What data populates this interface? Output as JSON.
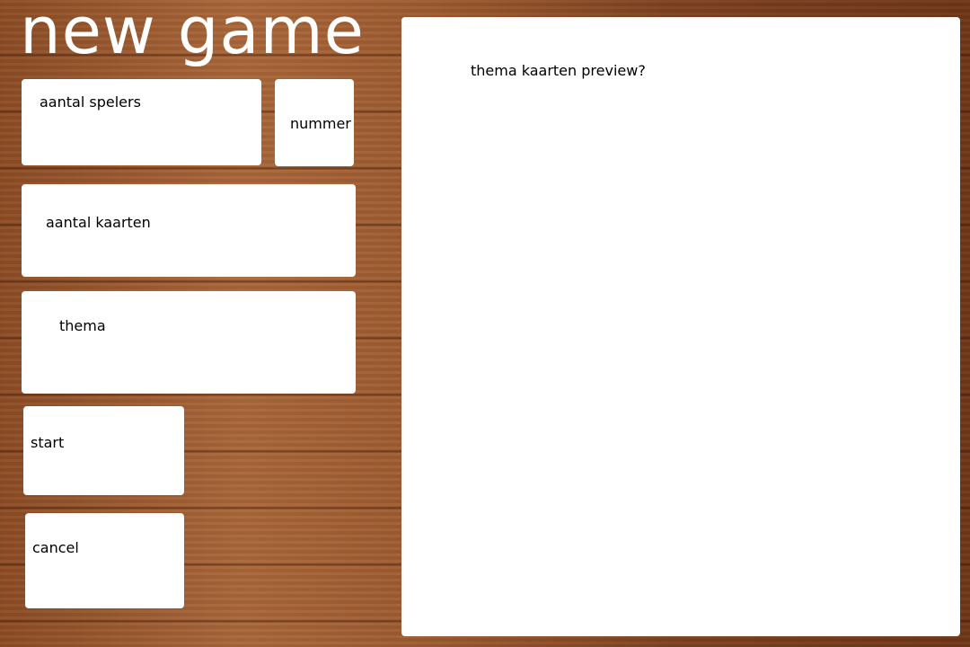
{
  "title": "new game",
  "fields": {
    "players_label": "aantal spelers",
    "number_label": "nummer",
    "cards_label": "aantal kaarten",
    "theme_label": "thema"
  },
  "buttons": {
    "start": "start",
    "cancel": "cancel"
  },
  "preview": {
    "label": "thema kaarten preview?"
  }
}
